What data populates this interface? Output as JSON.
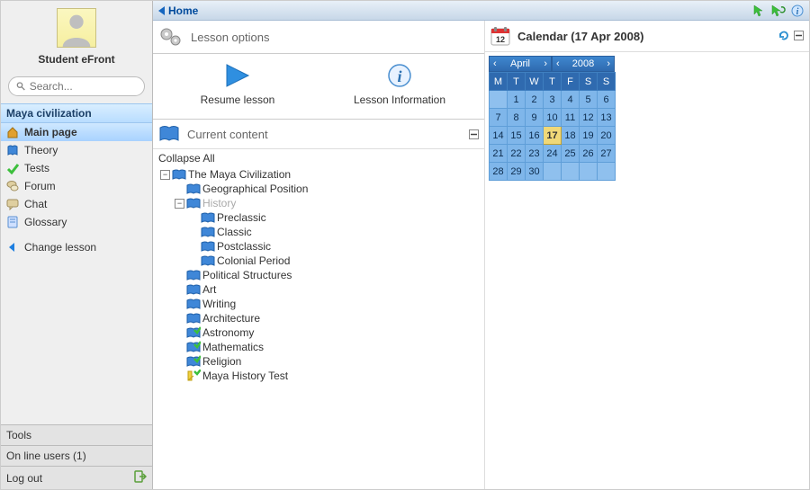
{
  "profile": {
    "name": "Student eFront"
  },
  "search": {
    "placeholder": "Search..."
  },
  "sidebar": {
    "lesson_title": "Maya civilization",
    "items": [
      {
        "label": "Main page",
        "icon": "home-icon",
        "active": true
      },
      {
        "label": "Theory",
        "icon": "book-icon",
        "active": false
      },
      {
        "label": "Tests",
        "icon": "check-icon",
        "active": false
      },
      {
        "label": "Forum",
        "icon": "forum-icon",
        "active": false
      },
      {
        "label": "Chat",
        "icon": "chat-icon",
        "active": false
      },
      {
        "label": "Glossary",
        "icon": "glossary-icon",
        "active": false
      }
    ],
    "change_lesson": "Change lesson",
    "tools": "Tools",
    "online_users": "On line users  (1)",
    "logout": "Log out"
  },
  "topbar": {
    "title": "Home"
  },
  "panels": {
    "options_title": "Lesson options",
    "content_title": "Current content",
    "calendar_title": "Calendar (17 Apr 2008)"
  },
  "actions": {
    "resume": "Resume lesson",
    "info": "Lesson Information"
  },
  "tree": {
    "collapse_all": "Collapse All",
    "nodes": [
      {
        "label": "The Maya Civilization",
        "level": 0,
        "expand": "-",
        "type": "book"
      },
      {
        "label": "Geographical Position",
        "level": 1,
        "expand": "",
        "type": "book"
      },
      {
        "label": "History",
        "level": 1,
        "expand": "-",
        "type": "book",
        "dim": true
      },
      {
        "label": "Preclassic",
        "level": 2,
        "expand": "",
        "type": "book"
      },
      {
        "label": "Classic",
        "level": 2,
        "expand": "",
        "type": "book"
      },
      {
        "label": "Postclassic",
        "level": 2,
        "expand": "",
        "type": "book"
      },
      {
        "label": "Colonial Period",
        "level": 2,
        "expand": "",
        "type": "book"
      },
      {
        "label": "Political Structures",
        "level": 1,
        "expand": "",
        "type": "book"
      },
      {
        "label": "Art",
        "level": 1,
        "expand": "",
        "type": "book"
      },
      {
        "label": "Writing",
        "level": 1,
        "expand": "",
        "type": "book"
      },
      {
        "label": "Architecture",
        "level": 1,
        "expand": "",
        "type": "book"
      },
      {
        "label": "Astronomy",
        "level": 1,
        "expand": "",
        "type": "test"
      },
      {
        "label": "Mathematics",
        "level": 1,
        "expand": "",
        "type": "test"
      },
      {
        "label": "Religion",
        "level": 1,
        "expand": "",
        "type": "test"
      },
      {
        "label": "Maya History Test",
        "level": 1,
        "expand": "",
        "type": "quiz"
      }
    ]
  },
  "calendar": {
    "month": "April",
    "year": "2008",
    "dow": [
      "M",
      "T",
      "W",
      "T",
      "F",
      "S",
      "S"
    ],
    "weeks": [
      [
        "",
        "1",
        "2",
        "3",
        "4",
        "5",
        "6"
      ],
      [
        "7",
        "8",
        "9",
        "10",
        "11",
        "12",
        "13"
      ],
      [
        "14",
        "15",
        "16",
        "17",
        "18",
        "19",
        "20"
      ],
      [
        "21",
        "22",
        "23",
        "24",
        "25",
        "26",
        "27"
      ],
      [
        "28",
        "29",
        "30",
        "",
        "",
        "",
        ""
      ]
    ],
    "today": "17"
  }
}
